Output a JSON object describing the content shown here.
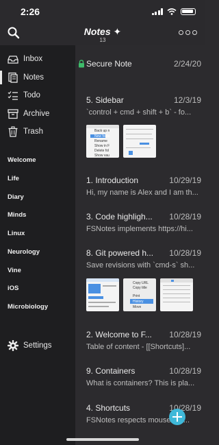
{
  "status": {
    "time": "2:26"
  },
  "header": {
    "title": "Notes ✦",
    "count": "13"
  },
  "sidebar": {
    "items": [
      {
        "label": "Inbox",
        "icon": "inbox-icon"
      },
      {
        "label": "Notes",
        "icon": "notes-icon",
        "active": true
      },
      {
        "label": "Todo",
        "icon": "todo-icon"
      },
      {
        "label": "Archive",
        "icon": "archive-icon"
      },
      {
        "label": "Trash",
        "icon": "trash-icon"
      }
    ],
    "tags": [
      "Welcome",
      "Life",
      "Diary",
      "Minds",
      "Linux",
      "Neurology",
      "Vine",
      "iOS",
      "Microbiology"
    ],
    "settings_label": "Settings"
  },
  "notes": [
    {
      "title": "Secure Note",
      "date": "2/24/20",
      "preview": "",
      "locked": true
    },
    {
      "title": "5. Sidebar",
      "date": "12/3/19",
      "preview": "`control + cmd + shift + b` - fo..."
    },
    {
      "title": "1. Introduction",
      "date": "10/29/19",
      "preview": "Hi, my name is Alex and I am th..."
    },
    {
      "title": "3. Code highligh...",
      "date": "10/28/19",
      "preview": "FSNotes implements https://hi..."
    },
    {
      "title": "8. Git powered h...",
      "date": "10/28/19",
      "preview": "Save revisions with `cmd-s` sh..."
    },
    {
      "title": "2. Welcome to F...",
      "date": "10/28/19",
      "preview": "Table of content - [[Shortcuts]..."
    },
    {
      "title": "9. Containers",
      "date": "10/28/19",
      "preview": "What is containers? This is pla..."
    },
    {
      "title": "4. Shortcuts",
      "date": "10/28/19",
      "preview": "FSNotes respects mouse/tou..."
    }
  ],
  "thumbs": {
    "t1": [
      "Back up n",
      "New folde",
      "Rename",
      "Show in F",
      "Delete fol",
      "Show vau"
    ],
    "t4": [
      "Copy URL",
      "Copy title",
      "Print",
      "History",
      "Move"
    ]
  },
  "colors": {
    "accent": "#3fb8d8",
    "sidebar_bg": "#1e1e20",
    "list_bg": "#2c2b2e"
  }
}
